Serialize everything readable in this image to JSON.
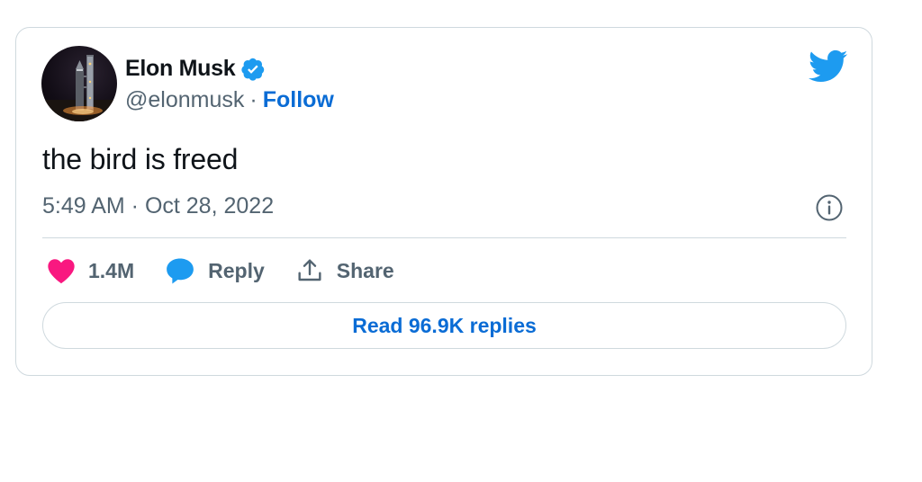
{
  "author": {
    "name": "Elon Musk",
    "handle": "@elonmusk",
    "separator": "·",
    "follow_label": "Follow",
    "verified": true
  },
  "tweet": {
    "text": "the bird is freed",
    "timestamp": "5:49 AM · Oct 28, 2022"
  },
  "actions": {
    "likes_count": "1.4M",
    "reply_label": "Reply",
    "share_label": "Share"
  },
  "read_replies_label": "Read 96.9K replies",
  "icons": {
    "brand": "twitter-bird-icon",
    "verified": "verified-badge-icon",
    "info": "info-icon",
    "like": "heart-icon",
    "reply": "reply-bubble-icon",
    "share": "share-icon"
  },
  "colors": {
    "accent": "#1d9bf0",
    "link": "#0a6cd5",
    "like": "#f91880",
    "text_primary": "#0f1419",
    "text_secondary": "#536471",
    "border": "#cfd9de"
  }
}
